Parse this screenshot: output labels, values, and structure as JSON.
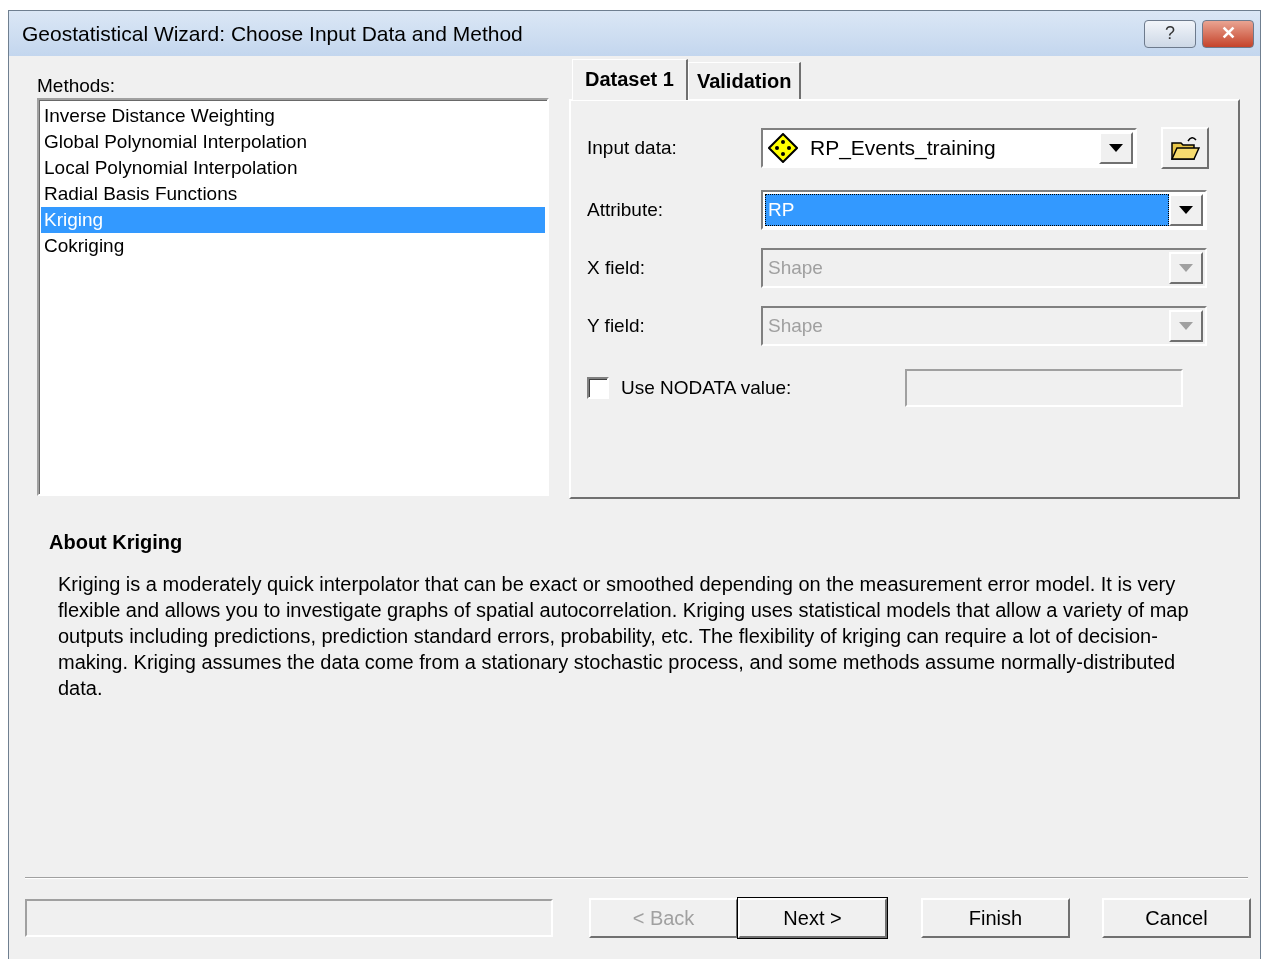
{
  "window": {
    "title": "Geostatistical Wizard: Choose Input Data and Method",
    "help_label": "?",
    "close_label": "✕"
  },
  "methods": {
    "label": "Methods:",
    "items": [
      {
        "label": "Inverse Distance Weighting",
        "selected": false
      },
      {
        "label": "Global Polynomial Interpolation",
        "selected": false
      },
      {
        "label": "Local Polynomial Interpolation",
        "selected": false
      },
      {
        "label": "Radial Basis Functions",
        "selected": false
      },
      {
        "label": "Kriging",
        "selected": true
      },
      {
        "label": "Cokriging",
        "selected": false
      }
    ]
  },
  "tabs": [
    {
      "label": "Dataset 1",
      "selected": true
    },
    {
      "label": "Validation",
      "selected": false
    }
  ],
  "fields": [
    {
      "kind": "dataset",
      "label": "Input data:",
      "value": "RP_Events_training",
      "disabled": false,
      "focused": false
    },
    {
      "kind": "combo",
      "label": "Attribute:",
      "value": "RP",
      "disabled": false,
      "focused": true
    },
    {
      "kind": "combo",
      "label": "X field:",
      "value": "Shape",
      "disabled": true,
      "focused": false
    },
    {
      "kind": "combo",
      "label": "Y field:",
      "value": "Shape",
      "disabled": true,
      "focused": false
    },
    {
      "kind": "checkbox",
      "label": "Use NODATA value:",
      "checked": false
    }
  ],
  "about": {
    "title": "About Kriging",
    "text": "Kriging is a moderately quick interpolator that can be exact or smoothed depending on the measurement error model. It is very flexible and allows you to investigate graphs of spatial autocorrelation. Kriging uses statistical models that allow a variety of map outputs including predictions, prediction standard errors, probability, etc. The flexibility of kriging can require a lot of decision-making. Kriging assumes the data come from a stationary stochastic process, and some methods assume normally-distributed data."
  },
  "buttons": [
    {
      "label": "< Back",
      "disabled": true,
      "default": false
    },
    {
      "label": "Next >",
      "disabled": false,
      "default": true
    },
    {
      "label": "Finish",
      "disabled": false,
      "default": false
    },
    {
      "label": "Cancel",
      "disabled": false,
      "default": false
    }
  ]
}
